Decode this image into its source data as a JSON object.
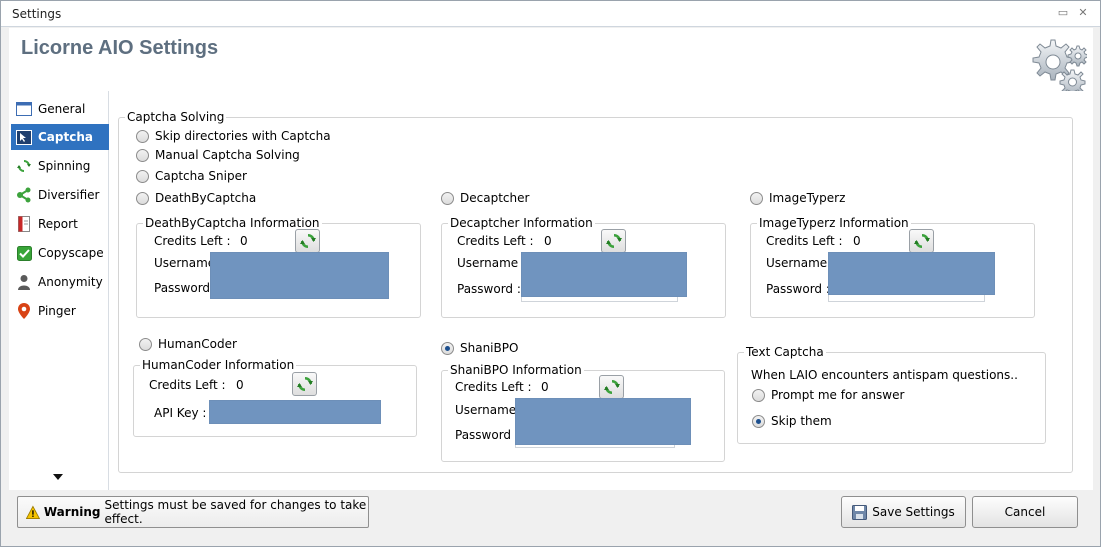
{
  "window": {
    "title": "Settings",
    "minimize_glyph": "▭",
    "close_glyph": "✕"
  },
  "header": {
    "app_title": "Licorne AIO Settings",
    "icon": "gears-icon"
  },
  "sidebar": {
    "items": [
      {
        "label": "General",
        "icon": "window-icon"
      },
      {
        "label": "Captcha",
        "icon": "cursor-icon",
        "active": true
      },
      {
        "label": "Spinning",
        "icon": "recycle-icon"
      },
      {
        "label": "Diversifier",
        "icon": "share-icon"
      },
      {
        "label": "Report",
        "icon": "document-icon"
      },
      {
        "label": "Copyscape",
        "icon": "checkbox-icon"
      },
      {
        "label": "Anonymity",
        "icon": "person-icon"
      },
      {
        "label": "Pinger",
        "icon": "map-pin-icon"
      }
    ]
  },
  "captcha": {
    "group_title": "Captcha Solving",
    "options": {
      "skip_dirs": "Skip directories with Captcha",
      "manual": "Manual Captcha Solving",
      "sniper": "Captcha Sniper",
      "dbc": "DeathByCaptcha",
      "decaptcher": "Decaptcher",
      "imagetyperz": "ImageTyperz",
      "humancoder": "HumanCoder",
      "shanibpo": "ShaniBPO"
    },
    "selected": "shanibpo",
    "labels": {
      "credits_left": "Credits Left :",
      "username": "Username :",
      "password": "Password :",
      "api_key": "API Key :"
    },
    "dbc_info": {
      "title": "DeathByCaptcha Information",
      "credits": "0"
    },
    "decaptcher_info": {
      "title": "Decaptcher Information",
      "credits": "0"
    },
    "imagetyperz_info": {
      "title": "ImageTyperz Information",
      "credits": "0"
    },
    "humancoder_info": {
      "title": "HumanCoder Information",
      "credits": "0"
    },
    "shanibpo_info": {
      "title": "ShaniBPO Information",
      "credits": "0"
    }
  },
  "text_captcha": {
    "title": "Text Captcha",
    "description": "When LAIO encounters antispam questions..",
    "prompt": "Prompt me for answer",
    "skip": "Skip them",
    "selected": "skip"
  },
  "footer": {
    "warning_bold": "Warning",
    "warning_text": "Settings must be saved for changes to take effect.",
    "save_label": "Save Settings",
    "cancel_label": "Cancel"
  },
  "colors": {
    "accent": "#2f72c0",
    "masked_field": "#7094bf",
    "title_text": "#5e6f80"
  }
}
